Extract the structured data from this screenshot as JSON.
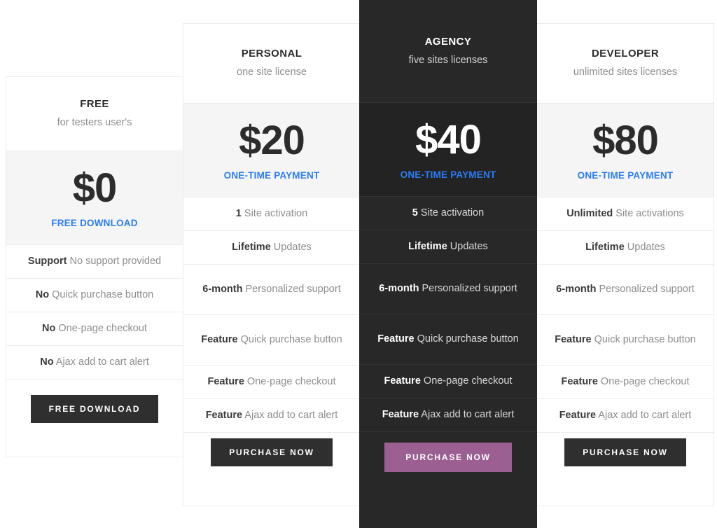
{
  "accent_colors": {
    "price_note_blue": "#2b7cf7",
    "featured_background": "#282828",
    "featured_price_background": "#232323",
    "price_band_background": "#f5f5f5",
    "button_dark": "#2f2f2f",
    "button_featured": "#9c5f91",
    "border": "#ececec"
  },
  "plans": [
    {
      "id": "free",
      "name": "FREE",
      "tagline": "for testers user's",
      "price": "$0",
      "price_note": "FREE DOWNLOAD",
      "features": [
        {
          "strong": "Support",
          "rest": " No support provided"
        },
        {
          "strong": "No",
          "rest": " Quick purchase button"
        },
        {
          "strong": "No",
          "rest": " One-page checkout"
        },
        {
          "strong": "No",
          "rest": " Ajax add to cart alert"
        }
      ],
      "cta": "FREE DOWNLOAD"
    },
    {
      "id": "personal",
      "name": "PERSONAL",
      "tagline": "one site license",
      "price": "$20",
      "price_note": "ONE-TIME PAYMENT",
      "features": [
        {
          "strong": "1",
          "rest": " Site activation"
        },
        {
          "strong": "Lifetime",
          "rest": " Updates"
        },
        {
          "strong": "6-month",
          "rest": " Personalized support"
        },
        {
          "strong": "Feature",
          "rest": " Quick purchase button"
        },
        {
          "strong": "Feature",
          "rest": " One-page checkout"
        },
        {
          "strong": "Feature",
          "rest": " Ajax add to cart alert"
        }
      ],
      "cta": "PURCHASE NOW"
    },
    {
      "id": "agency",
      "name": "AGENCY",
      "tagline": "five sites licenses",
      "price": "$40",
      "price_note": "ONE-TIME PAYMENT",
      "features": [
        {
          "strong": "5",
          "rest": " Site activation"
        },
        {
          "strong": "Lifetime",
          "rest": " Updates"
        },
        {
          "strong": "6-month",
          "rest": " Personalized support"
        },
        {
          "strong": "Feature",
          "rest": " Quick purchase button"
        },
        {
          "strong": "Feature",
          "rest": " One-page checkout"
        },
        {
          "strong": "Feature",
          "rest": " Ajax add to cart alert"
        }
      ],
      "cta": "PURCHASE NOW"
    },
    {
      "id": "developer",
      "name": "DEVELOPER",
      "tagline": "unlimited sites licenses",
      "price": "$80",
      "price_note": "ONE-TIME PAYMENT",
      "features": [
        {
          "strong": "Unlimited",
          "rest": " Site activations"
        },
        {
          "strong": "Lifetime",
          "rest": " Updates"
        },
        {
          "strong": "6-month",
          "rest": " Personalized support"
        },
        {
          "strong": "Feature",
          "rest": " Quick purchase button"
        },
        {
          "strong": "Feature",
          "rest": " One-page checkout"
        },
        {
          "strong": "Feature",
          "rest": " Ajax add to cart alert"
        }
      ],
      "cta": "PURCHASE NOW"
    }
  ]
}
